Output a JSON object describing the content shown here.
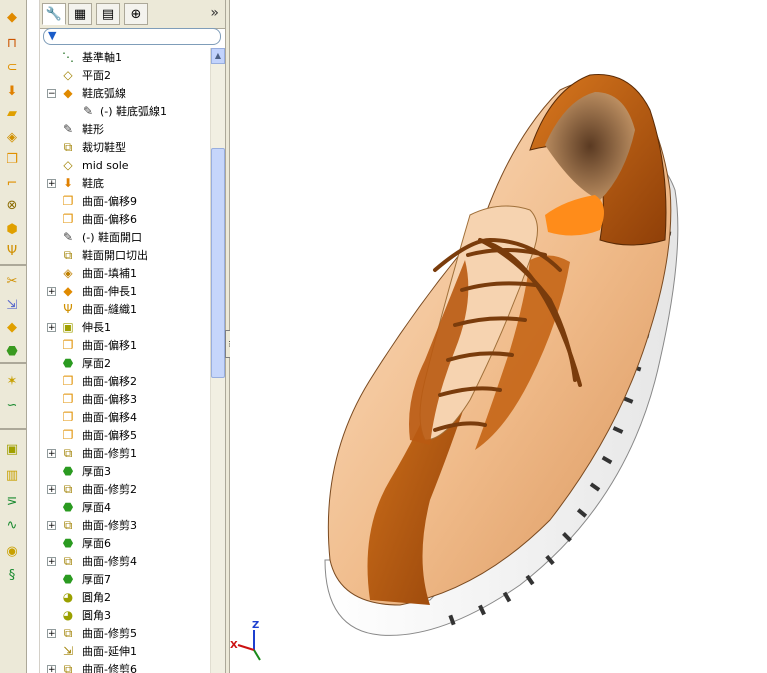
{
  "toolbar": {
    "buttons": [
      {
        "icon": "extrude-feature-icon",
        "glyph": "◆",
        "color": "#e08a00",
        "interactable": true
      },
      {
        "icon": "revolve-feature-icon",
        "glyph": "⊓",
        "color": "#cc5500",
        "interactable": true
      },
      {
        "icon": "sweep-feature-icon",
        "glyph": "⊂",
        "color": "#e09000",
        "interactable": true
      },
      {
        "icon": "loft-feature-icon",
        "glyph": "⬇",
        "color": "#e08000",
        "interactable": true
      },
      {
        "icon": "boundary-surface-icon",
        "glyph": "▰",
        "color": "#e0a000",
        "interactable": true
      },
      {
        "icon": "planar-surface-icon",
        "glyph": "◈",
        "color": "#d09000",
        "interactable": true
      },
      {
        "icon": "offset-surface-icon",
        "glyph": "❐",
        "color": "#e09000",
        "interactable": true
      },
      {
        "icon": "radiate-surface-icon",
        "glyph": "⌐",
        "color": "#e09000",
        "interactable": true
      },
      {
        "icon": "delete-face-icon",
        "glyph": "⊗",
        "color": "#8a6a00",
        "interactable": true
      },
      {
        "icon": "replace-face-icon",
        "glyph": "⬢",
        "color": "#e0a000",
        "interactable": true
      },
      {
        "icon": "knit-surface-icon",
        "glyph": "Ψ",
        "color": "#d09000",
        "interactable": true
      },
      {
        "icon": "trim-surface-icon",
        "glyph": "✂",
        "color": "#d09000",
        "interactable": true
      },
      {
        "icon": "extend-surface-icon",
        "glyph": "⇲",
        "color": "#5a6acc",
        "interactable": true
      },
      {
        "icon": "fill-surface-icon",
        "glyph": "◆",
        "color": "#e0a000",
        "interactable": true
      },
      {
        "icon": "thicken-icon",
        "glyph": "⬣",
        "color": "#3a9a20",
        "interactable": true
      },
      {
        "icon": "split-line-icon",
        "glyph": "✶",
        "color": "#c8a000",
        "interactable": true
      },
      {
        "icon": "curve-through-points-icon",
        "glyph": "∽",
        "color": "#1a8a30",
        "interactable": true
      },
      {
        "icon": "sketch-rectangle-icon",
        "glyph": "▣",
        "color": "#a0a000",
        "interactable": true
      },
      {
        "icon": "mirror-icon",
        "glyph": "▥",
        "color": "#c8a000",
        "interactable": true
      },
      {
        "icon": "polyline-icon",
        "glyph": "⋝",
        "color": "#1a8a30",
        "interactable": true
      },
      {
        "icon": "spline-icon",
        "glyph": "∿",
        "color": "#1a8a30",
        "interactable": true
      },
      {
        "icon": "helix-icon",
        "glyph": "◉",
        "color": "#c8a000",
        "interactable": true
      },
      {
        "icon": "spiral-icon",
        "glyph": "§",
        "color": "#1a8a30",
        "interactable": true
      }
    ]
  },
  "panel_tabs": [
    {
      "icon": "feature-manager-icon",
      "glyph": "🔧",
      "active": true
    },
    {
      "icon": "property-manager-icon",
      "glyph": "▦",
      "active": false
    },
    {
      "icon": "configuration-manager-icon",
      "glyph": "▤",
      "active": false
    },
    {
      "icon": "dimxpert-manager-icon",
      "glyph": "⊕",
      "active": false
    }
  ],
  "panel_more_label": "»",
  "filter": {
    "icon": "filter-icon",
    "glyph": "▼"
  },
  "tree": {
    "items": [
      {
        "label": "基準軸1",
        "icon": "axis-icon",
        "glyph": "⋱",
        "color": "#1a6a1a",
        "expander": "",
        "indent": false
      },
      {
        "label": "平面2",
        "icon": "plane-icon",
        "glyph": "◇",
        "color": "#a08000",
        "expander": "",
        "indent": false
      },
      {
        "label": "鞋底弧線",
        "icon": "surface-feature-icon",
        "glyph": "◆",
        "color": "#e08a00",
        "expander": "−",
        "indent": false
      },
      {
        "label": "(-) 鞋底弧線1",
        "icon": "sketch-icon",
        "glyph": "✎",
        "color": "#444444",
        "expander": "",
        "indent": true
      },
      {
        "label": "鞋形",
        "icon": "sketch-icon",
        "glyph": "✎",
        "color": "#444444",
        "expander": "",
        "indent": false
      },
      {
        "label": "裁切鞋型",
        "icon": "split-line-icon",
        "glyph": "⧉",
        "color": "#a08000",
        "expander": "",
        "indent": false
      },
      {
        "label": "mid sole",
        "icon": "plane-icon",
        "glyph": "◇",
        "color": "#a08000",
        "expander": "",
        "indent": false
      },
      {
        "label": "鞋底",
        "icon": "surface-loft-icon",
        "glyph": "⬇",
        "color": "#e08000",
        "expander": "+",
        "indent": false
      },
      {
        "label": "曲面-偏移9",
        "icon": "offset-surface-icon",
        "glyph": "❐",
        "color": "#e09000",
        "expander": "",
        "indent": false
      },
      {
        "label": "曲面-偏移6",
        "icon": "offset-surface-icon",
        "glyph": "❐",
        "color": "#e09000",
        "expander": "",
        "indent": false
      },
      {
        "label": "(-) 鞋面開口",
        "icon": "sketch-icon",
        "glyph": "✎",
        "color": "#444444",
        "expander": "",
        "indent": false
      },
      {
        "label": "鞋面開口切出",
        "icon": "split-line-icon",
        "glyph": "⧉",
        "color": "#a08000",
        "expander": "",
        "indent": false
      },
      {
        "label": "曲面-填補1",
        "icon": "fill-surface-icon",
        "glyph": "◈",
        "color": "#c08000",
        "expander": "",
        "indent": false
      },
      {
        "label": "曲面-伸長1",
        "icon": "extrude-surface-icon",
        "glyph": "◆",
        "color": "#e08a00",
        "expander": "+",
        "indent": false
      },
      {
        "label": "曲面-縫織1",
        "icon": "knit-surface-icon",
        "glyph": "Ψ",
        "color": "#d09000",
        "expander": "",
        "indent": false
      },
      {
        "label": "伸長1",
        "icon": "extrude-boss-icon",
        "glyph": "▣",
        "color": "#a0a000",
        "expander": "+",
        "indent": false
      },
      {
        "label": "曲面-偏移1",
        "icon": "offset-surface-icon",
        "glyph": "❐",
        "color": "#e09000",
        "expander": "",
        "indent": false
      },
      {
        "label": "厚面2",
        "icon": "thicken-icon",
        "glyph": "⬣",
        "color": "#2a9a20",
        "expander": "",
        "indent": false
      },
      {
        "label": "曲面-偏移2",
        "icon": "offset-surface-icon",
        "glyph": "❐",
        "color": "#e09000",
        "expander": "",
        "indent": false
      },
      {
        "label": "曲面-偏移3",
        "icon": "offset-surface-icon",
        "glyph": "❐",
        "color": "#e09000",
        "expander": "",
        "indent": false
      },
      {
        "label": "曲面-偏移4",
        "icon": "offset-surface-icon",
        "glyph": "❐",
        "color": "#e09000",
        "expander": "",
        "indent": false
      },
      {
        "label": "曲面-偏移5",
        "icon": "offset-surface-icon",
        "glyph": "❐",
        "color": "#e09000",
        "expander": "",
        "indent": false
      },
      {
        "label": "曲面-修剪1",
        "icon": "trim-surface-icon",
        "glyph": "⧉",
        "color": "#a08000",
        "expander": "+",
        "indent": false
      },
      {
        "label": "厚面3",
        "icon": "thicken-icon",
        "glyph": "⬣",
        "color": "#2a9a20",
        "expander": "",
        "indent": false
      },
      {
        "label": "曲面-修剪2",
        "icon": "trim-surface-icon",
        "glyph": "⧉",
        "color": "#a08000",
        "expander": "+",
        "indent": false
      },
      {
        "label": "厚面4",
        "icon": "thicken-icon",
        "glyph": "⬣",
        "color": "#2a9a20",
        "expander": "",
        "indent": false
      },
      {
        "label": "曲面-修剪3",
        "icon": "trim-surface-icon",
        "glyph": "⧉",
        "color": "#a08000",
        "expander": "+",
        "indent": false
      },
      {
        "label": "厚面6",
        "icon": "thicken-icon",
        "glyph": "⬣",
        "color": "#2a9a20",
        "expander": "",
        "indent": false
      },
      {
        "label": "曲面-修剪4",
        "icon": "trim-surface-icon",
        "glyph": "⧉",
        "color": "#a08000",
        "expander": "+",
        "indent": false
      },
      {
        "label": "厚面7",
        "icon": "thicken-icon",
        "glyph": "⬣",
        "color": "#2a9a20",
        "expander": "",
        "indent": false
      },
      {
        "label": "圓角2",
        "icon": "fillet-icon",
        "glyph": "◕",
        "color": "#9aa000",
        "expander": "",
        "indent": false
      },
      {
        "label": "圓角3",
        "icon": "fillet-icon",
        "glyph": "◕",
        "color": "#9aa000",
        "expander": "",
        "indent": false
      },
      {
        "label": "曲面-修剪5",
        "icon": "trim-surface-icon",
        "glyph": "⧉",
        "color": "#a08000",
        "expander": "+",
        "indent": false
      },
      {
        "label": "曲面-延伸1",
        "icon": "extend-surface-icon",
        "glyph": "⇲",
        "color": "#a08000",
        "expander": "",
        "indent": false
      },
      {
        "label": "曲面-修剪6",
        "icon": "trim-surface-icon",
        "glyph": "⧉",
        "color": "#a08000",
        "expander": "+",
        "indent": false
      }
    ]
  },
  "viewport": {
    "model": "shoe-model",
    "triad": {
      "x_label": "X",
      "z_label": "Z"
    },
    "colors": {
      "upper_light": "#f2c49a",
      "upper_dark": "#b95a12",
      "lace": "#7a3c0c",
      "sole": "#f4f4f4",
      "insole": "#ff8c1a",
      "tongue": "#f6d3b0"
    }
  }
}
